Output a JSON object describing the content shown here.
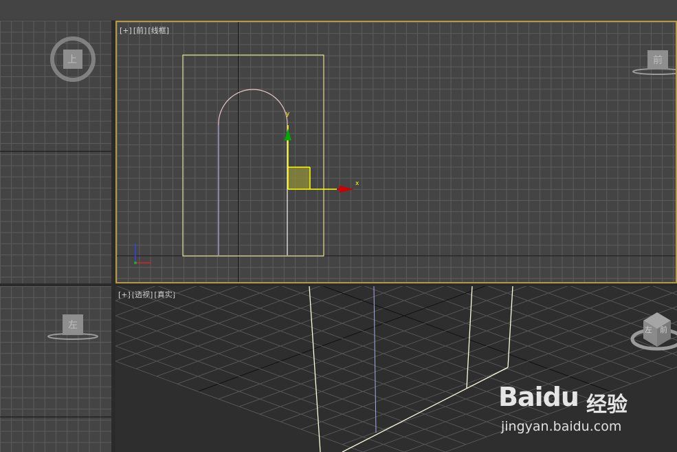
{
  "viewports": {
    "top": {
      "cube_label": "上"
    },
    "front": {
      "label_plus": "[+]",
      "label_view": "[前]",
      "label_mode": "[线框]",
      "cube_label": "前",
      "gizmo_x": "x",
      "gizmo_y": "y"
    },
    "left": {
      "cube_label": "左"
    },
    "perspective": {
      "label_plus": "[+]",
      "label_view": "[透视]",
      "label_mode": "[真实]",
      "cube_left": "左",
      "cube_front": "前"
    }
  },
  "watermark": {
    "brand": "Bai",
    "brand_du": "du",
    "cn": "经验",
    "url": "jingyan.baidu.com"
  },
  "colors": {
    "active_border": "#b39a43",
    "selection": "#ffff99",
    "gizmo_x": "#cc0000",
    "gizmo_y": "#00aa00"
  }
}
